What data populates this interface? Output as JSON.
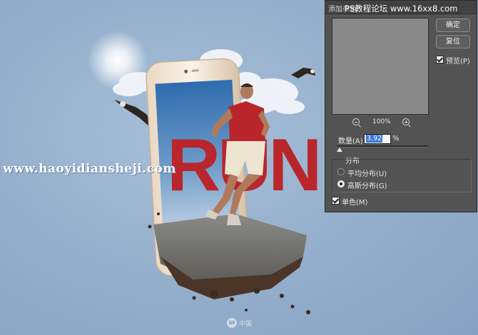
{
  "canvas": {
    "watermark_left": "www.haoyidiansheji.com",
    "headline": "RUN",
    "bottom_logo_badge": "UI",
    "bottom_logo_text": "中国"
  },
  "site_watermark": "PS教程论坛 www.16xx8.com",
  "dialog": {
    "title": "添加杂色",
    "buttons": {
      "ok": "确定",
      "reset": "复位"
    },
    "preview": {
      "label": "预览(P)",
      "checked": true
    },
    "zoom_level": "100%",
    "amount": {
      "label": "数量(A):",
      "value": "3.92",
      "unit": "%"
    },
    "distribution": {
      "group_label": "分布",
      "options": [
        {
          "label": "平均分布(U)",
          "checked": false
        },
        {
          "label": "高斯分布(G)",
          "checked": true
        }
      ]
    },
    "monochromatic": {
      "label": "单色(M)",
      "checked": true
    }
  },
  "colors": {
    "sky": "#93aecb",
    "run_red": "#b9262b",
    "dialog_bg": "#535353",
    "selection_blue": "#3875d7"
  }
}
